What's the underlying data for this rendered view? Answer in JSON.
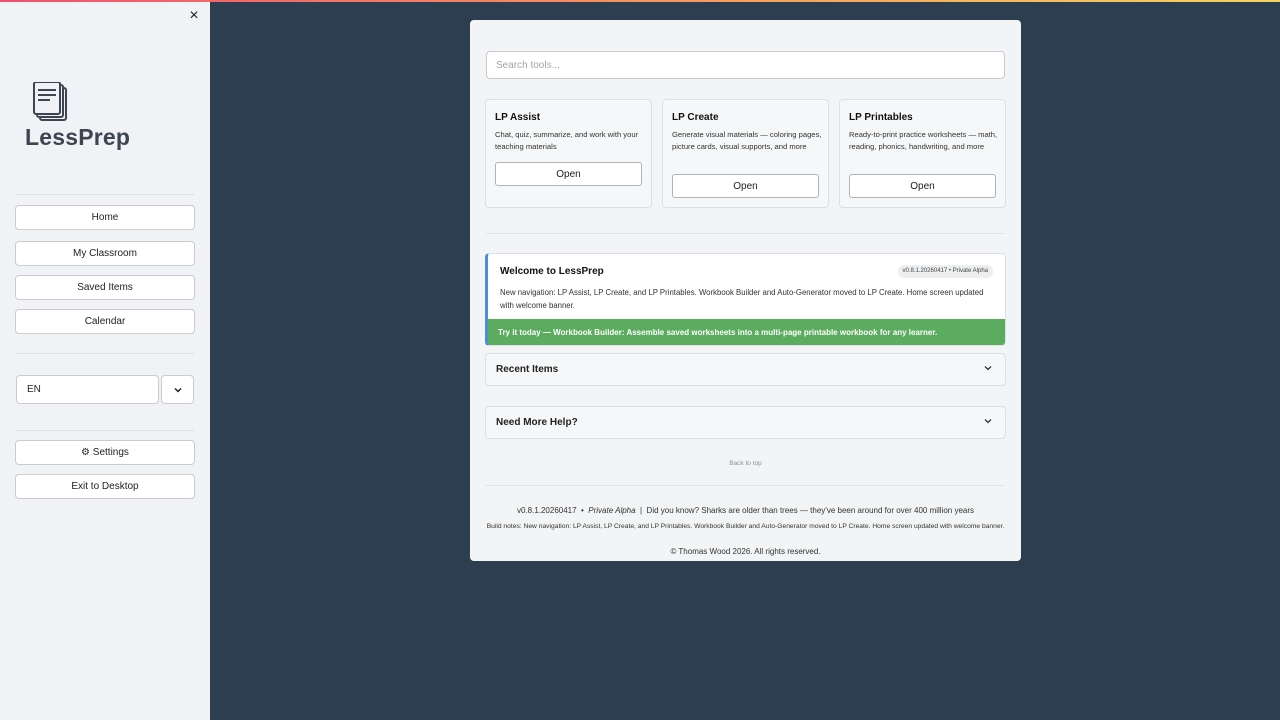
{
  "sidebar": {
    "close_label": "×",
    "logo_text": "LessPrep",
    "nav": [
      {
        "label": "Home"
      },
      {
        "label": "My Classroom"
      },
      {
        "label": "Saved Items"
      },
      {
        "label": "Calendar"
      }
    ],
    "language": {
      "value": "EN"
    },
    "settings_label": "⚙ Settings",
    "exit_label": "Exit to Desktop"
  },
  "main": {
    "search": {
      "placeholder": "Search tools..."
    },
    "tools": [
      {
        "title": "LP Assist",
        "description": "Chat, quiz, summarize, and work with your teaching materials",
        "button": "Open"
      },
      {
        "title": "LP Create",
        "description": "Generate visual materials — coloring pages, picture cards, visual supports, and more",
        "button": "Open"
      },
      {
        "title": "LP Printables",
        "description": "Ready-to-print practice worksheets — math, reading, phonics, handwriting, and more",
        "button": "Open"
      }
    ],
    "welcome": {
      "title": "Welcome to LessPrep",
      "version": "v0.8.1.20260417 • Private Alpha",
      "body": "New navigation: LP Assist, LP Create, and LP Printables. Workbook Builder and Auto-Generator moved to LP Create. Home screen updated with welcome banner.",
      "try_today": "Try it today — Workbook Builder: Assemble saved worksheets into a multi-page printable workbook for any learner."
    },
    "accordions": [
      {
        "label": "Recent Items"
      },
      {
        "label": "Need More Help?"
      }
    ],
    "back_to_top": "Back to top",
    "footer": {
      "version": "v0.8.1.20260417",
      "channel": "Private Alpha",
      "fact": "Did you know? Sharks are older than trees — they've been around for over 400 million years",
      "build_notes": "Build notes: New navigation: LP Assist, LP Create, and LP Printables. Workbook Builder and Auto-Generator moved to LP Create. Home screen updated with welcome banner.",
      "copyright": "© Thomas Wood 2026. All rights reserved."
    }
  },
  "colors": {
    "background": "#2e3e51",
    "sidebar": "#f0f2f5",
    "accent_blue": "#4a8fd8",
    "success_green": "#5bac5f"
  }
}
